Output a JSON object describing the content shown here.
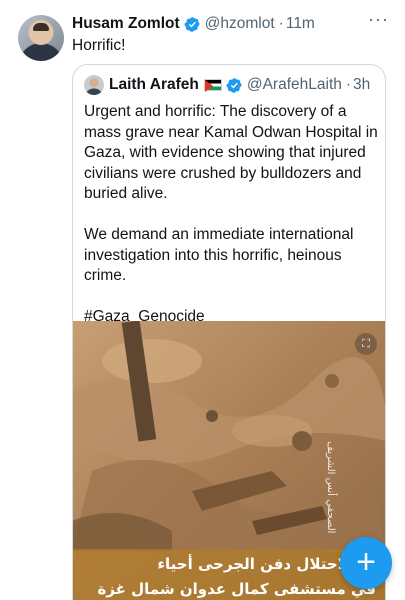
{
  "tweet": {
    "author_name": "Husam Zomlot",
    "author_handle": "@hzomlot",
    "separator": "·",
    "time": "11m",
    "text": "Horrific!",
    "more_label": "···"
  },
  "quote": {
    "author_name": "Laith Arafeh",
    "author_handle": "@ArafehLaith",
    "separator": "·",
    "time": "3h",
    "paragraphs": [
      "Urgent and horrific: The discovery of a mass grave near Kamal Odwan Hospital in Gaza, with evidence showing that injured civilians were crushed by bulldozers and buried alive.",
      "We demand an immediate international investigation into this horrific, heinous crime.",
      "#Gaza_Genocide"
    ],
    "media": {
      "caption_line1": "الاحتلال دفن الجرحى أحياء",
      "caption_line2": "في مستشفى كمال عدوان شمال غزة",
      "side_text": "الصحفي أنس الشريف",
      "watermark": "⛶"
    }
  },
  "fab": {
    "label": "+"
  },
  "colors": {
    "accent": "#1d9bf0",
    "text": "#0f1419",
    "secondary": "#536471",
    "border": "#cfd9de"
  },
  "icons": [
    "verified-badge-icon",
    "more-icon",
    "compose-icon",
    "palestine-flag-icon"
  ]
}
